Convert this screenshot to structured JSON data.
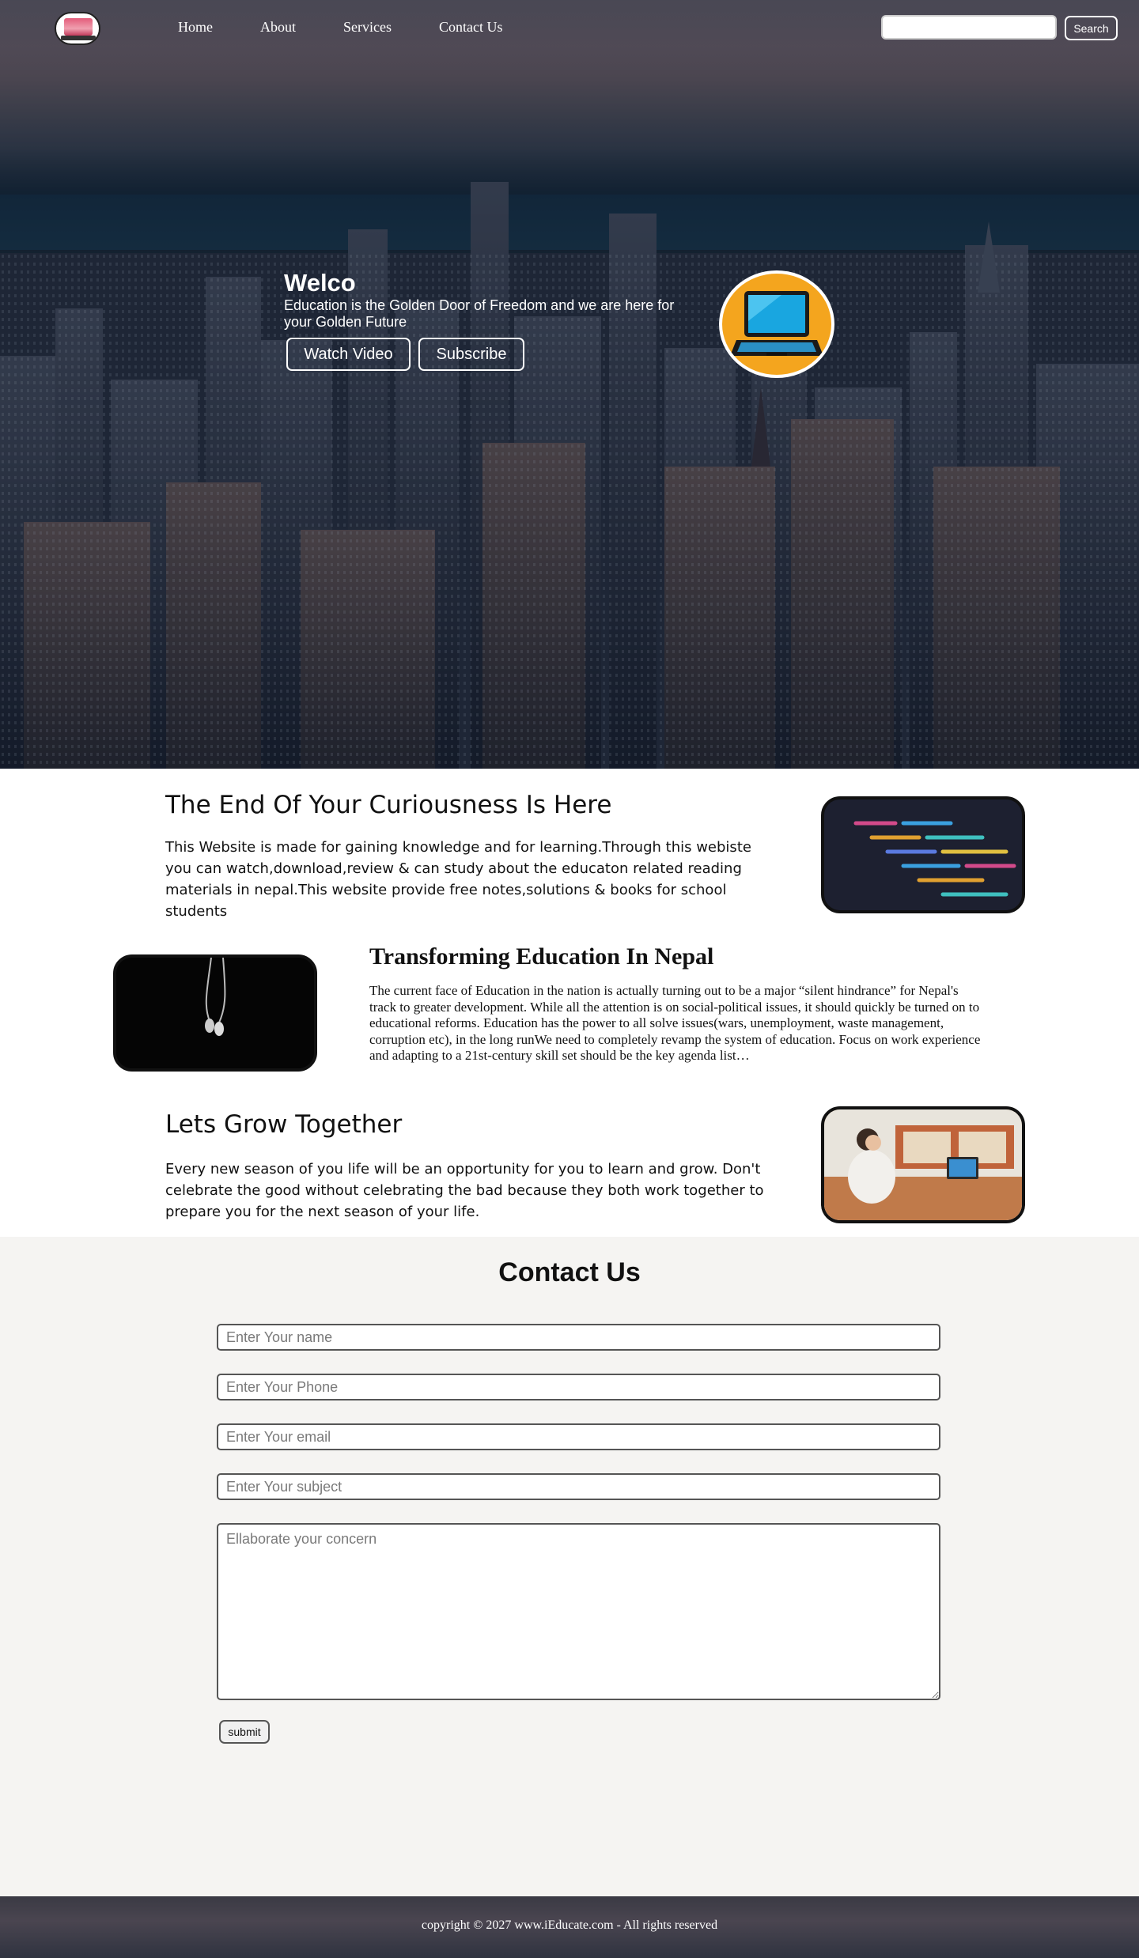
{
  "nav": {
    "links": [
      "Home",
      "About",
      "Services",
      "Contact Us"
    ],
    "search_placeholder": "",
    "search_button": "Search"
  },
  "hero": {
    "title": "Welco",
    "subtitle": "Education is the Golden Door of Freedom and we are here for your Golden Future",
    "watch_button": "Watch Video",
    "subscribe_button": "Subscribe"
  },
  "sections": [
    {
      "title": "The End Of Your Curiousness Is Here",
      "text": "This Website is made for gaining knowledge and for learning.Through this webiste you can watch,download,review & can study about the educaton related reading materials in nepal.This website provide free notes,solutions & books for school students"
    },
    {
      "title": "Transforming Education In Nepal",
      "text": "The current face of Education in the nation is actually turning out to be a major “silent hindrance” for Nepal's track to greater development. While all the attention is on social-political issues, it should quickly be turned on to educational reforms. Education has the power to all solve issues(wars, unemployment, waste management, corruption etc), in the long runWe need to completely revamp the system of education. Focus on work experience and adapting to a 21st-century skill set should be the key agenda list…"
    },
    {
      "title": "Lets Grow Together",
      "text": "Every new season of you life will be an opportunity for you to learn and grow. Don't celebrate the good without celebrating the bad because they both work together to prepare you for the next season of your life."
    }
  ],
  "contact": {
    "title": "Contact Us",
    "name_placeholder": "Enter Your name",
    "phone_placeholder": "Enter Your Phone",
    "email_placeholder": "Enter Your email",
    "subject_placeholder": "Enter Your subject",
    "message_placeholder": "Ellaborate your concern",
    "submit_label": "submit"
  },
  "footer": {
    "text": "copyright © 2027 www.iEducate.com - All rights reserved"
  },
  "colors": {
    "hero_dark": "#1b2a3a",
    "laptop_circle": "#f4a51e",
    "contact_bg": "#f5f4f2",
    "border": "#111111"
  },
  "icons": {
    "logo": "laptop-logo-icon",
    "hero": "laptop-icon"
  }
}
